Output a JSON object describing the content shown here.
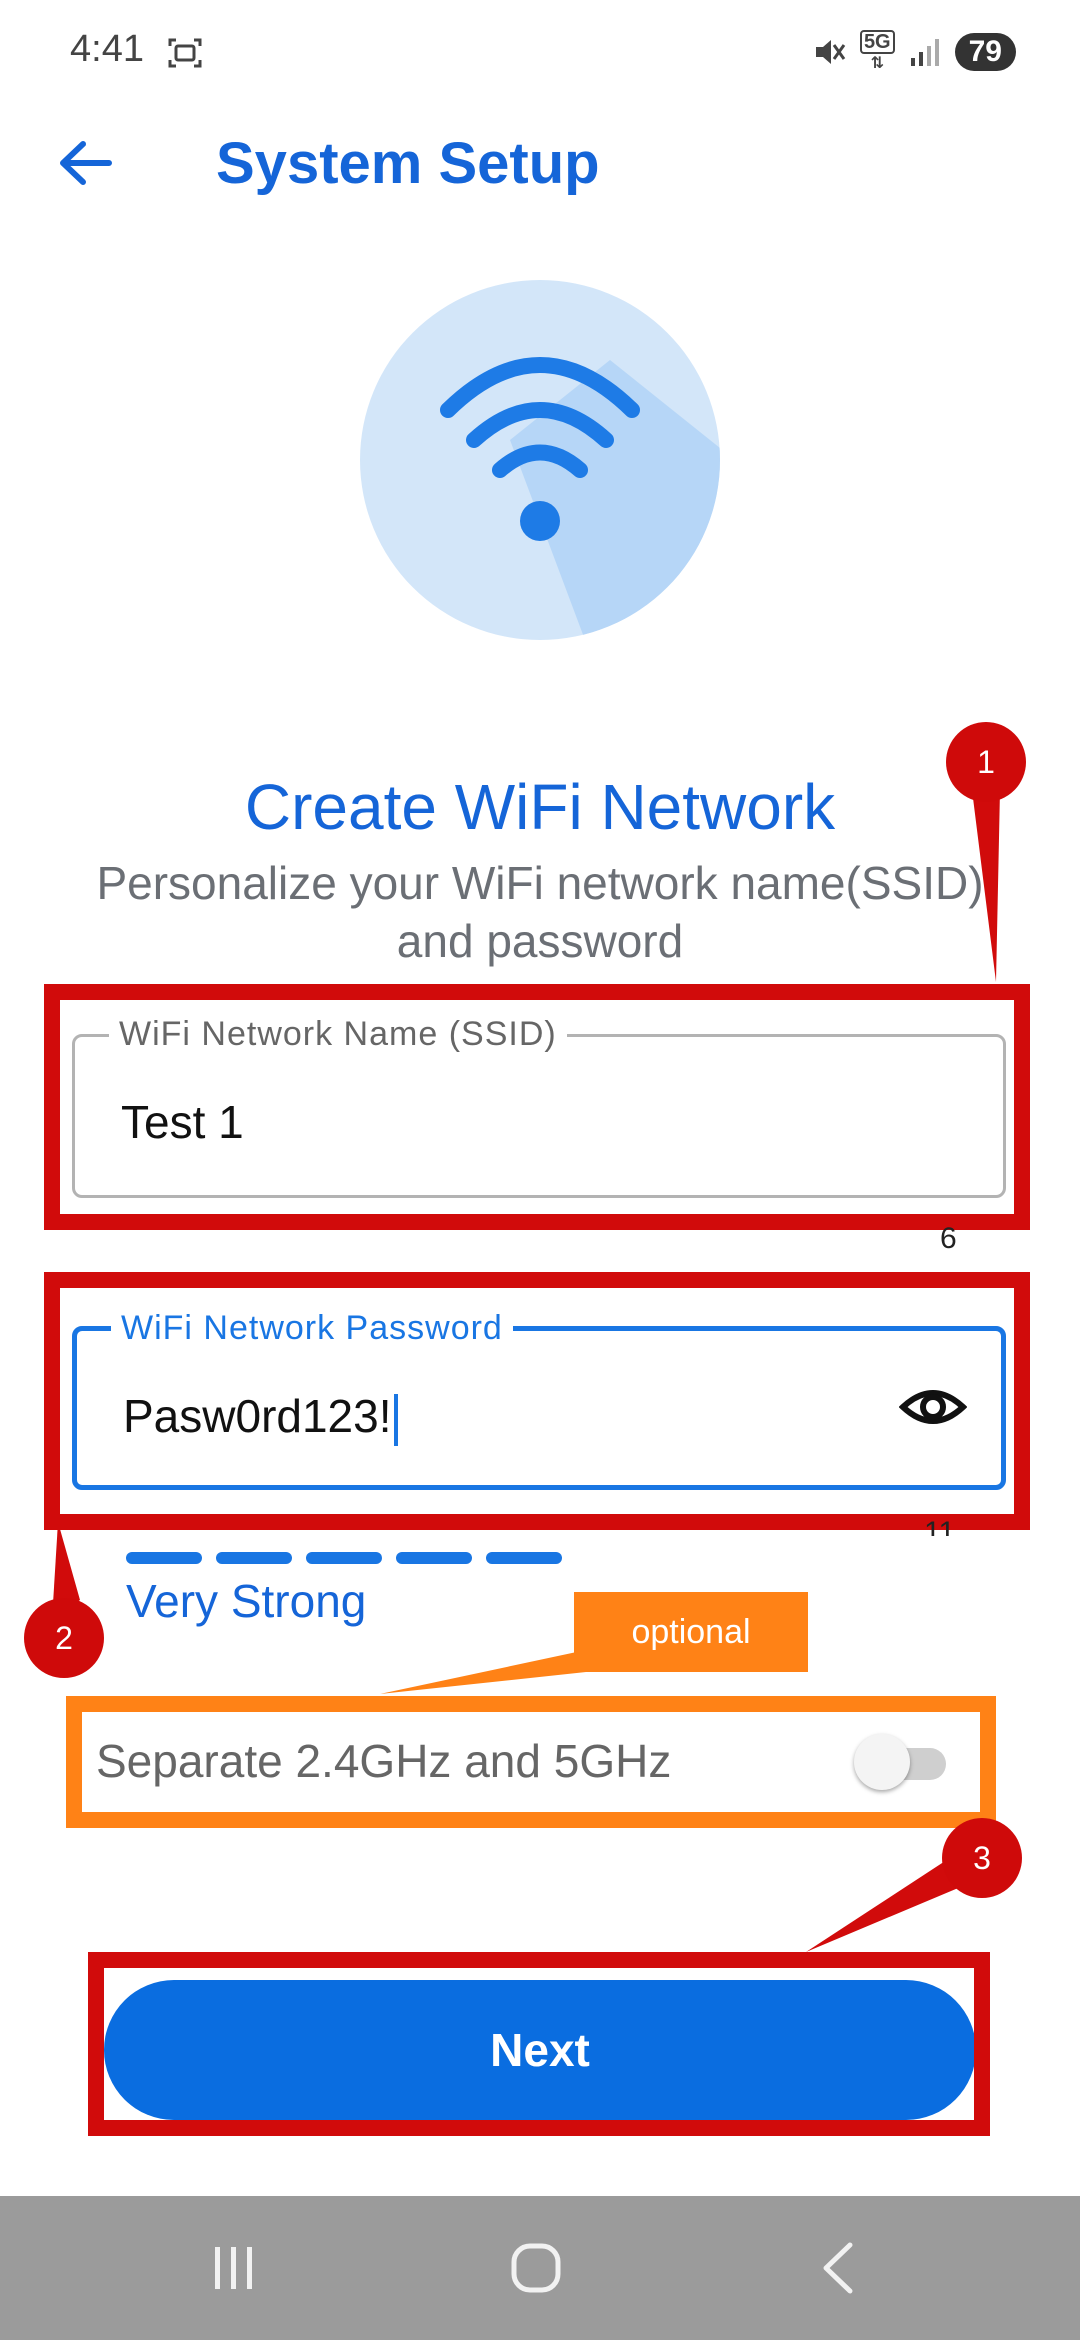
{
  "status_bar": {
    "time": "4:41",
    "battery": "79",
    "network_label": "5G",
    "icons": [
      "screenshot-icon",
      "mute-icon",
      "5g-icon",
      "signal-icon",
      "battery-icon"
    ]
  },
  "app_bar": {
    "title": "System Setup",
    "back_icon": "back-arrow-icon"
  },
  "hero": {
    "icon": "wifi-icon"
  },
  "content": {
    "heading": "Create WiFi Network",
    "subtitle": "Personalize your WiFi network name(SSID) and password"
  },
  "form": {
    "ssid": {
      "label": "WiFi Network Name (SSID)",
      "value": "Test 1"
    },
    "password": {
      "label": "WiFi Network Password",
      "value": "Pasw0rd123!",
      "visibility_icon": "eye-icon"
    },
    "strength": {
      "label": "Very Strong",
      "segments_filled": 5,
      "segments_total": 5
    },
    "separate_bands": {
      "label": "Separate 2.4GHz and 5GHz",
      "enabled": false
    }
  },
  "next_button": {
    "label": "Next"
  },
  "annotations": {
    "badges": [
      "1",
      "2",
      "3"
    ],
    "optional_label": "optional",
    "stray_marks": [
      "6",
      "11"
    ]
  },
  "nav_bar": {
    "icons": [
      "recent-apps-icon",
      "home-icon",
      "back-icon"
    ]
  },
  "colors": {
    "primary": "#1565d8",
    "button": "#0a6de0",
    "annotation_red": "#d10b0b",
    "annotation_orange": "#ff8216"
  }
}
